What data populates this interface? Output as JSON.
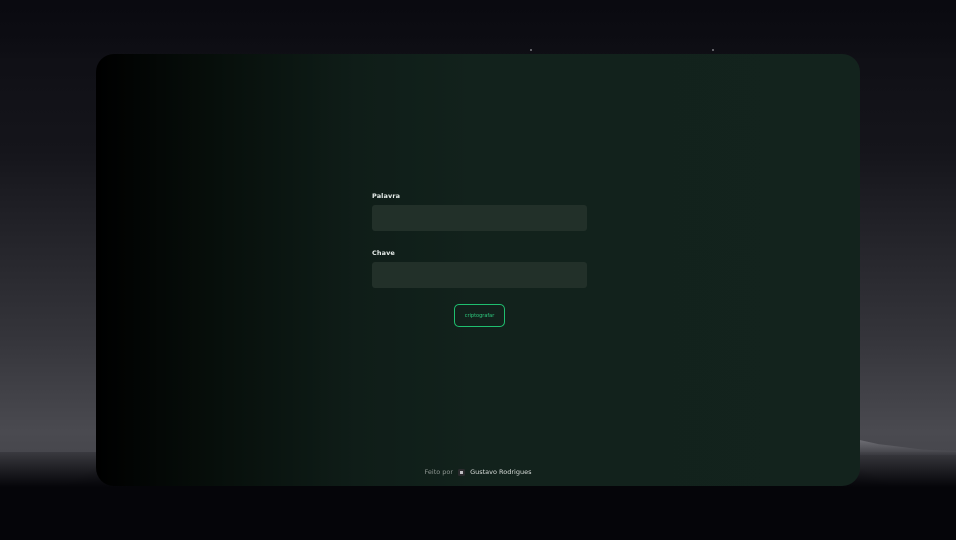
{
  "form": {
    "word_label": "Palavra",
    "word_value": "",
    "key_label": "Chave",
    "key_value": "",
    "submit_label": "criptografar"
  },
  "footer": {
    "made_by": "Feito por",
    "author": "Gustavo Rodrigues"
  },
  "colors": {
    "accent": "#1fbf6f",
    "card_dark": "#000000",
    "card_green": "#13231d",
    "input_bg": "#223029"
  }
}
